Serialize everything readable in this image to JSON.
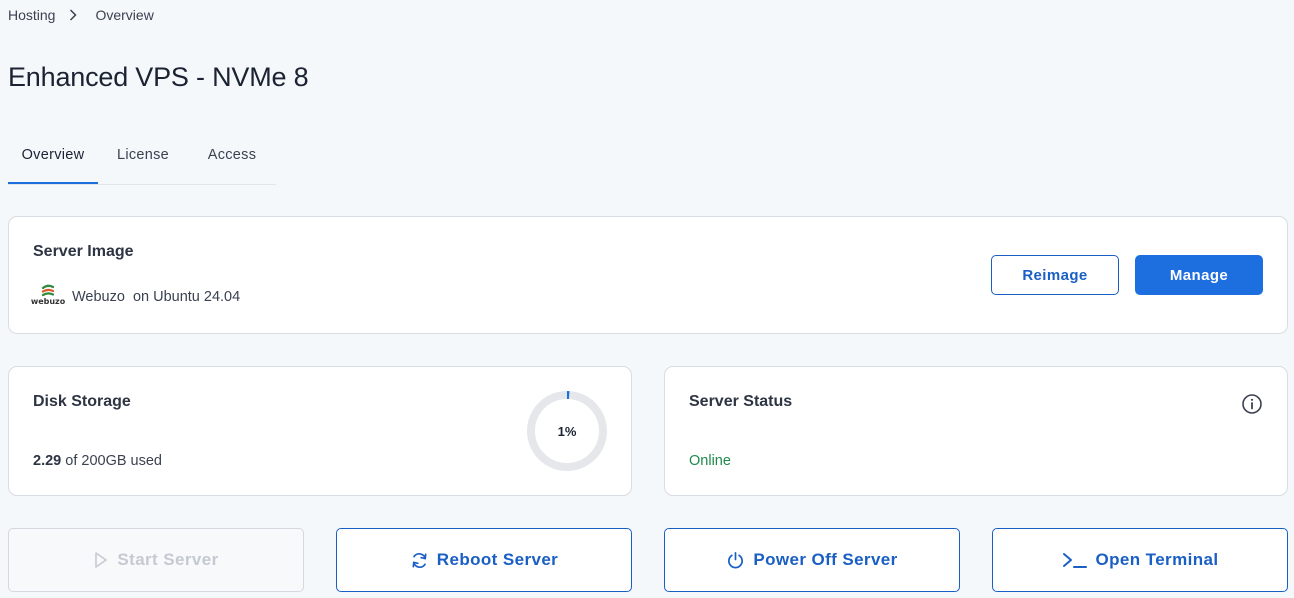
{
  "breadcrumb": {
    "items": [
      "Hosting",
      "Overview"
    ],
    "separator_icon": "chevron-right-icon"
  },
  "page": {
    "title": "Enhanced VPS - NVMe 8"
  },
  "tabs": [
    {
      "label": "Overview",
      "active": true
    },
    {
      "label": "License",
      "active": false
    },
    {
      "label": "Access",
      "active": false
    }
  ],
  "server_image": {
    "title": "Server Image",
    "logo_text": "webuzo",
    "name": "Webuzo",
    "os": "on Ubuntu 24.04",
    "reimage_label": "Reimage",
    "manage_label": "Manage"
  },
  "disk_storage": {
    "title": "Disk Storage",
    "used": "2.29",
    "total_text": "of 200GB used",
    "percent": 1,
    "percent_label": "1%"
  },
  "server_status": {
    "title": "Server Status",
    "value": "Online",
    "info_icon": "info-circle-icon"
  },
  "actions": {
    "start": {
      "label": "Start Server",
      "icon": "play-icon",
      "disabled": true
    },
    "reboot": {
      "label": "Reboot Server",
      "icon": "refresh-icon"
    },
    "power_off": {
      "label": "Power Off Server",
      "icon": "power-icon"
    },
    "terminal": {
      "label": "Open Terminal",
      "icon": "terminal-icon"
    }
  },
  "colors": {
    "accent": "#1d6fe0",
    "online": "#1f8a4c",
    "background": "#f5f8fb"
  }
}
